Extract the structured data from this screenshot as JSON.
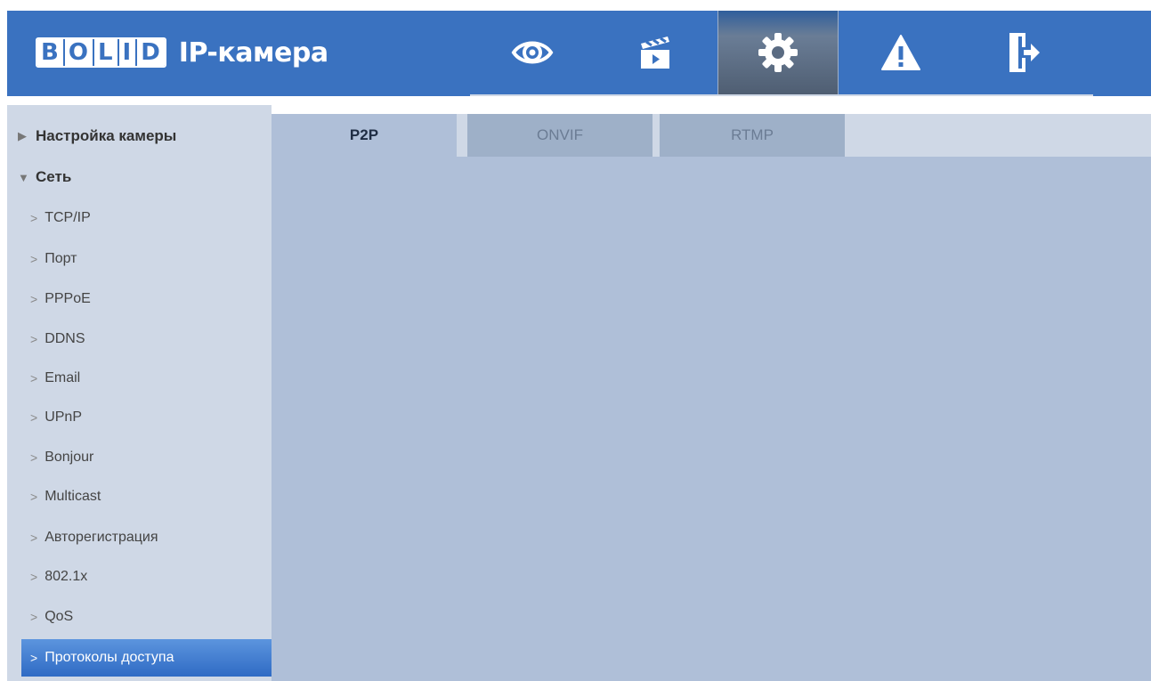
{
  "header": {
    "logo_letters": [
      "B",
      "O",
      "L",
      "I",
      "D"
    ],
    "app_title": "IP-камера",
    "nav": [
      {
        "name": "live-view",
        "icon": "eye-icon",
        "active": false
      },
      {
        "name": "playback",
        "icon": "clapperboard-icon",
        "active": false
      },
      {
        "name": "settings",
        "icon": "gear-icon",
        "active": true
      },
      {
        "name": "alarm",
        "icon": "warning-icon",
        "active": false
      },
      {
        "name": "logout",
        "icon": "exit-door-icon",
        "active": false
      }
    ],
    "colors": {
      "bar": "#3a72c0",
      "active": "#5a6b82"
    }
  },
  "sidebar": {
    "sections": [
      {
        "label": "Настройка камеры",
        "expanded": false
      },
      {
        "label": "Сеть",
        "expanded": true
      }
    ],
    "items": [
      {
        "label": "TCP/IP"
      },
      {
        "label": "Порт"
      },
      {
        "label": "PPPoE"
      },
      {
        "label": "DDNS"
      },
      {
        "label": "Email"
      },
      {
        "label": "UPnP"
      },
      {
        "label": "Bonjour"
      },
      {
        "label": "Multicast"
      },
      {
        "label": "Авторегистрация"
      },
      {
        "label": "802.1x"
      },
      {
        "label": "QoS"
      },
      {
        "label": "Протоколы доступа",
        "selected": true
      }
    ]
  },
  "tabs": [
    {
      "label": "P2P",
      "active": true
    },
    {
      "label": "ONVIF",
      "active": false
    },
    {
      "label": "RTMP",
      "active": false
    }
  ]
}
